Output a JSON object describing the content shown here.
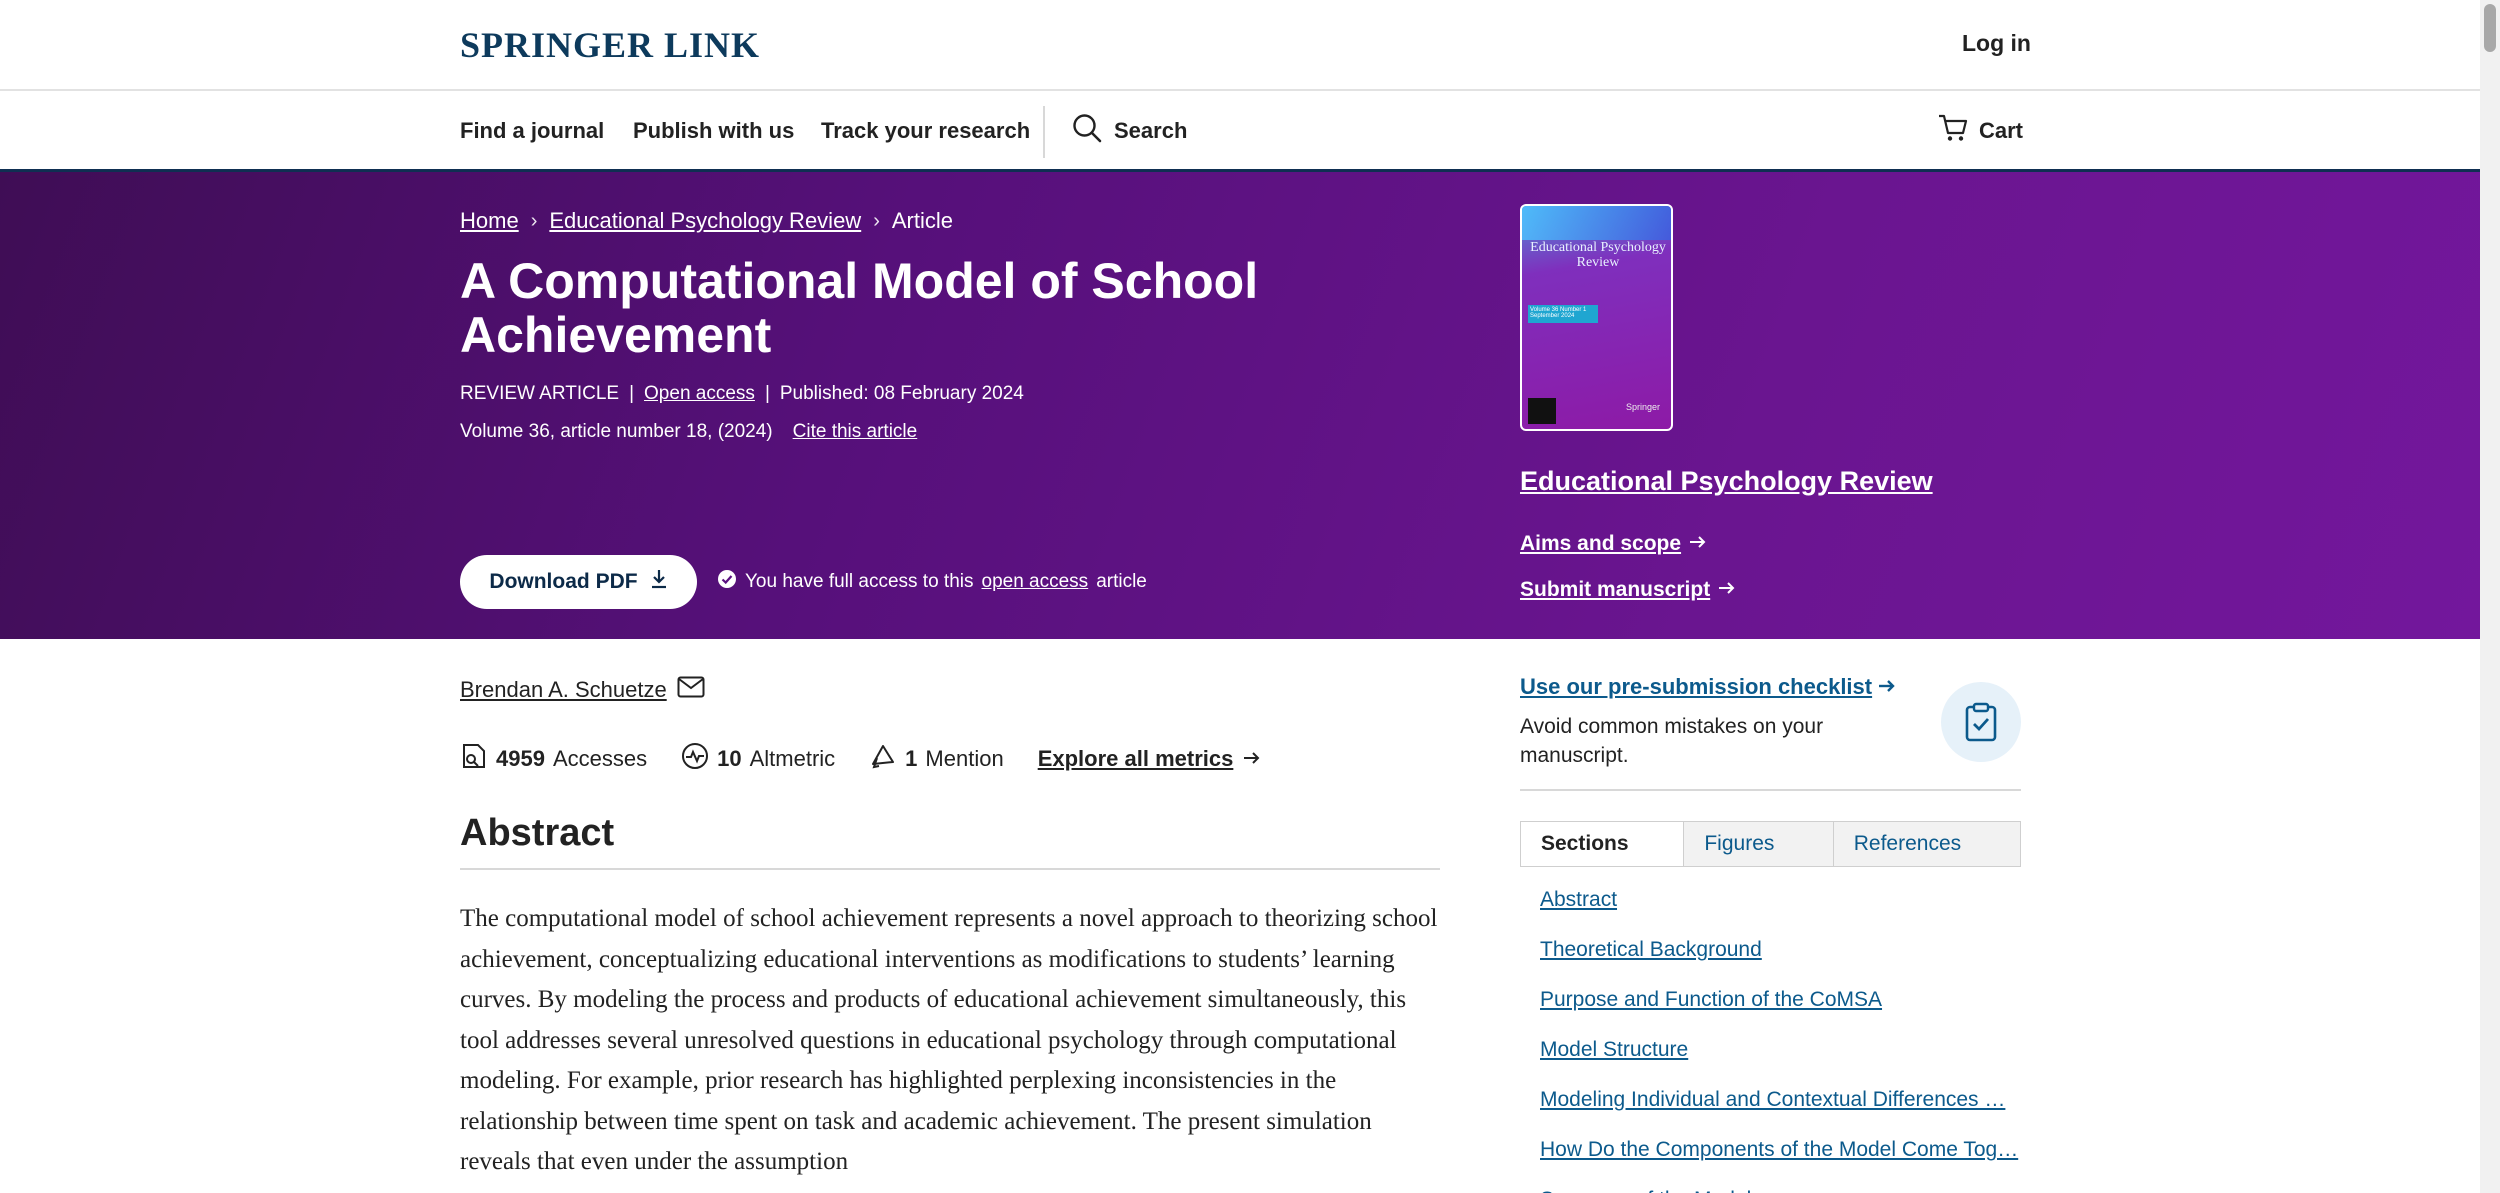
{
  "header": {
    "logo": "SPRINGER LINK",
    "login_label": "Log in"
  },
  "nav": {
    "items": [
      {
        "label": "Find a journal"
      },
      {
        "label": "Publish with us"
      },
      {
        "label": "Track your research"
      }
    ],
    "search_label": "Search",
    "cart_label": "Cart"
  },
  "breadcrumb": {
    "home": "Home",
    "journal": "Educational Psychology Review",
    "current": "Article",
    "separator": "›"
  },
  "article": {
    "title": "A Computational Model of School Achievement",
    "type": "REVIEW ARTICLE",
    "open_access": "Open access",
    "published": "Published: 08 February 2024",
    "volume": "Volume 36, article number 18, (2024)",
    "cite": "Cite this article",
    "download_label": "Download PDF",
    "access_prefix": "You have full access to this",
    "access_link": "open access",
    "access_suffix": "article"
  },
  "journal": {
    "cover_title": "Educational Psychology Review",
    "cover_issue": "Volume 36 Number 1 September 2024",
    "cover_publisher": "Springer",
    "name": "Educational Psychology Review",
    "aims_label": "Aims and scope",
    "submit_label": "Submit manuscript"
  },
  "author": {
    "name": "Brendan A. Schuetze"
  },
  "metrics": {
    "accesses_value": "4959",
    "accesses_label": "Accesses",
    "altmetric_value": "10",
    "altmetric_label": "Altmetric",
    "mention_value": "1",
    "mention_label": "Mention",
    "explore_label": "Explore all metrics"
  },
  "abstract": {
    "heading": "Abstract",
    "text": "The computational model of school achievement represents a novel approach to theorizing school achievement, conceptualizing educational interventions as modifications to students’ learning curves. By modeling the process and products of educational achievement simultaneously, this tool addresses several unresolved questions in educational psychology through computational modeling. For example, prior research has highlighted perplexing inconsistencies in the relationship between time spent on task and academic achievement. The present simulation reveals that even under the assumption"
  },
  "checklist": {
    "link_label": "Use our pre-submission checklist",
    "description": "Avoid common mistakes on your manuscript."
  },
  "sidebar": {
    "tabs": [
      {
        "label": "Sections"
      },
      {
        "label": "Figures"
      },
      {
        "label": "References"
      }
    ],
    "sections": [
      {
        "label": "Abstract"
      },
      {
        "label": "Theoretical Background"
      },
      {
        "label": "Purpose and Function of the CoMSA"
      },
      {
        "label": "Model Structure"
      },
      {
        "label": "Modeling Individual and Contextual Differences …"
      },
      {
        "label": "How Do the Components of the Model Come Tog…"
      },
      {
        "label": "Summary of the Model"
      }
    ]
  },
  "colors": {
    "brand": "#0d3a5c",
    "hero": "#5a1180",
    "link": "#0c5a8c"
  }
}
